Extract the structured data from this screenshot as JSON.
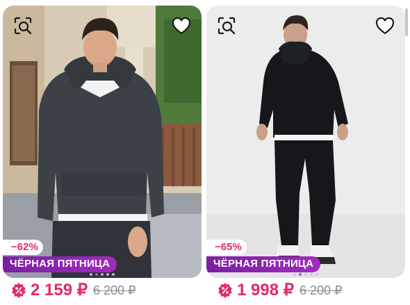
{
  "products": [
    {
      "discount": "−62%",
      "promo": "ЧЁРНАЯ ПЯТНИЦА",
      "price": "2 159 ₽",
      "old_price": "6 200 ₽",
      "photo_dots_total": 5,
      "photo_dots_active": 1,
      "icons": [
        "find-similar-icon",
        "heart-icon",
        "percent-badge-icon"
      ]
    },
    {
      "discount": "−65%",
      "promo": "ЧЁРНАЯ ПЯТНИЦА",
      "price": "1 998 ₽",
      "old_price": "6 200 ₽",
      "photo_dots_total": 5,
      "photo_dots_active": 1,
      "icons": [
        "find-similar-icon",
        "heart-icon",
        "percent-badge-icon"
      ]
    }
  ],
  "colors": {
    "accent_pink": "#e3296b",
    "promo_purple": "#8e24aa",
    "old_price_gray": "#8a8a96"
  }
}
